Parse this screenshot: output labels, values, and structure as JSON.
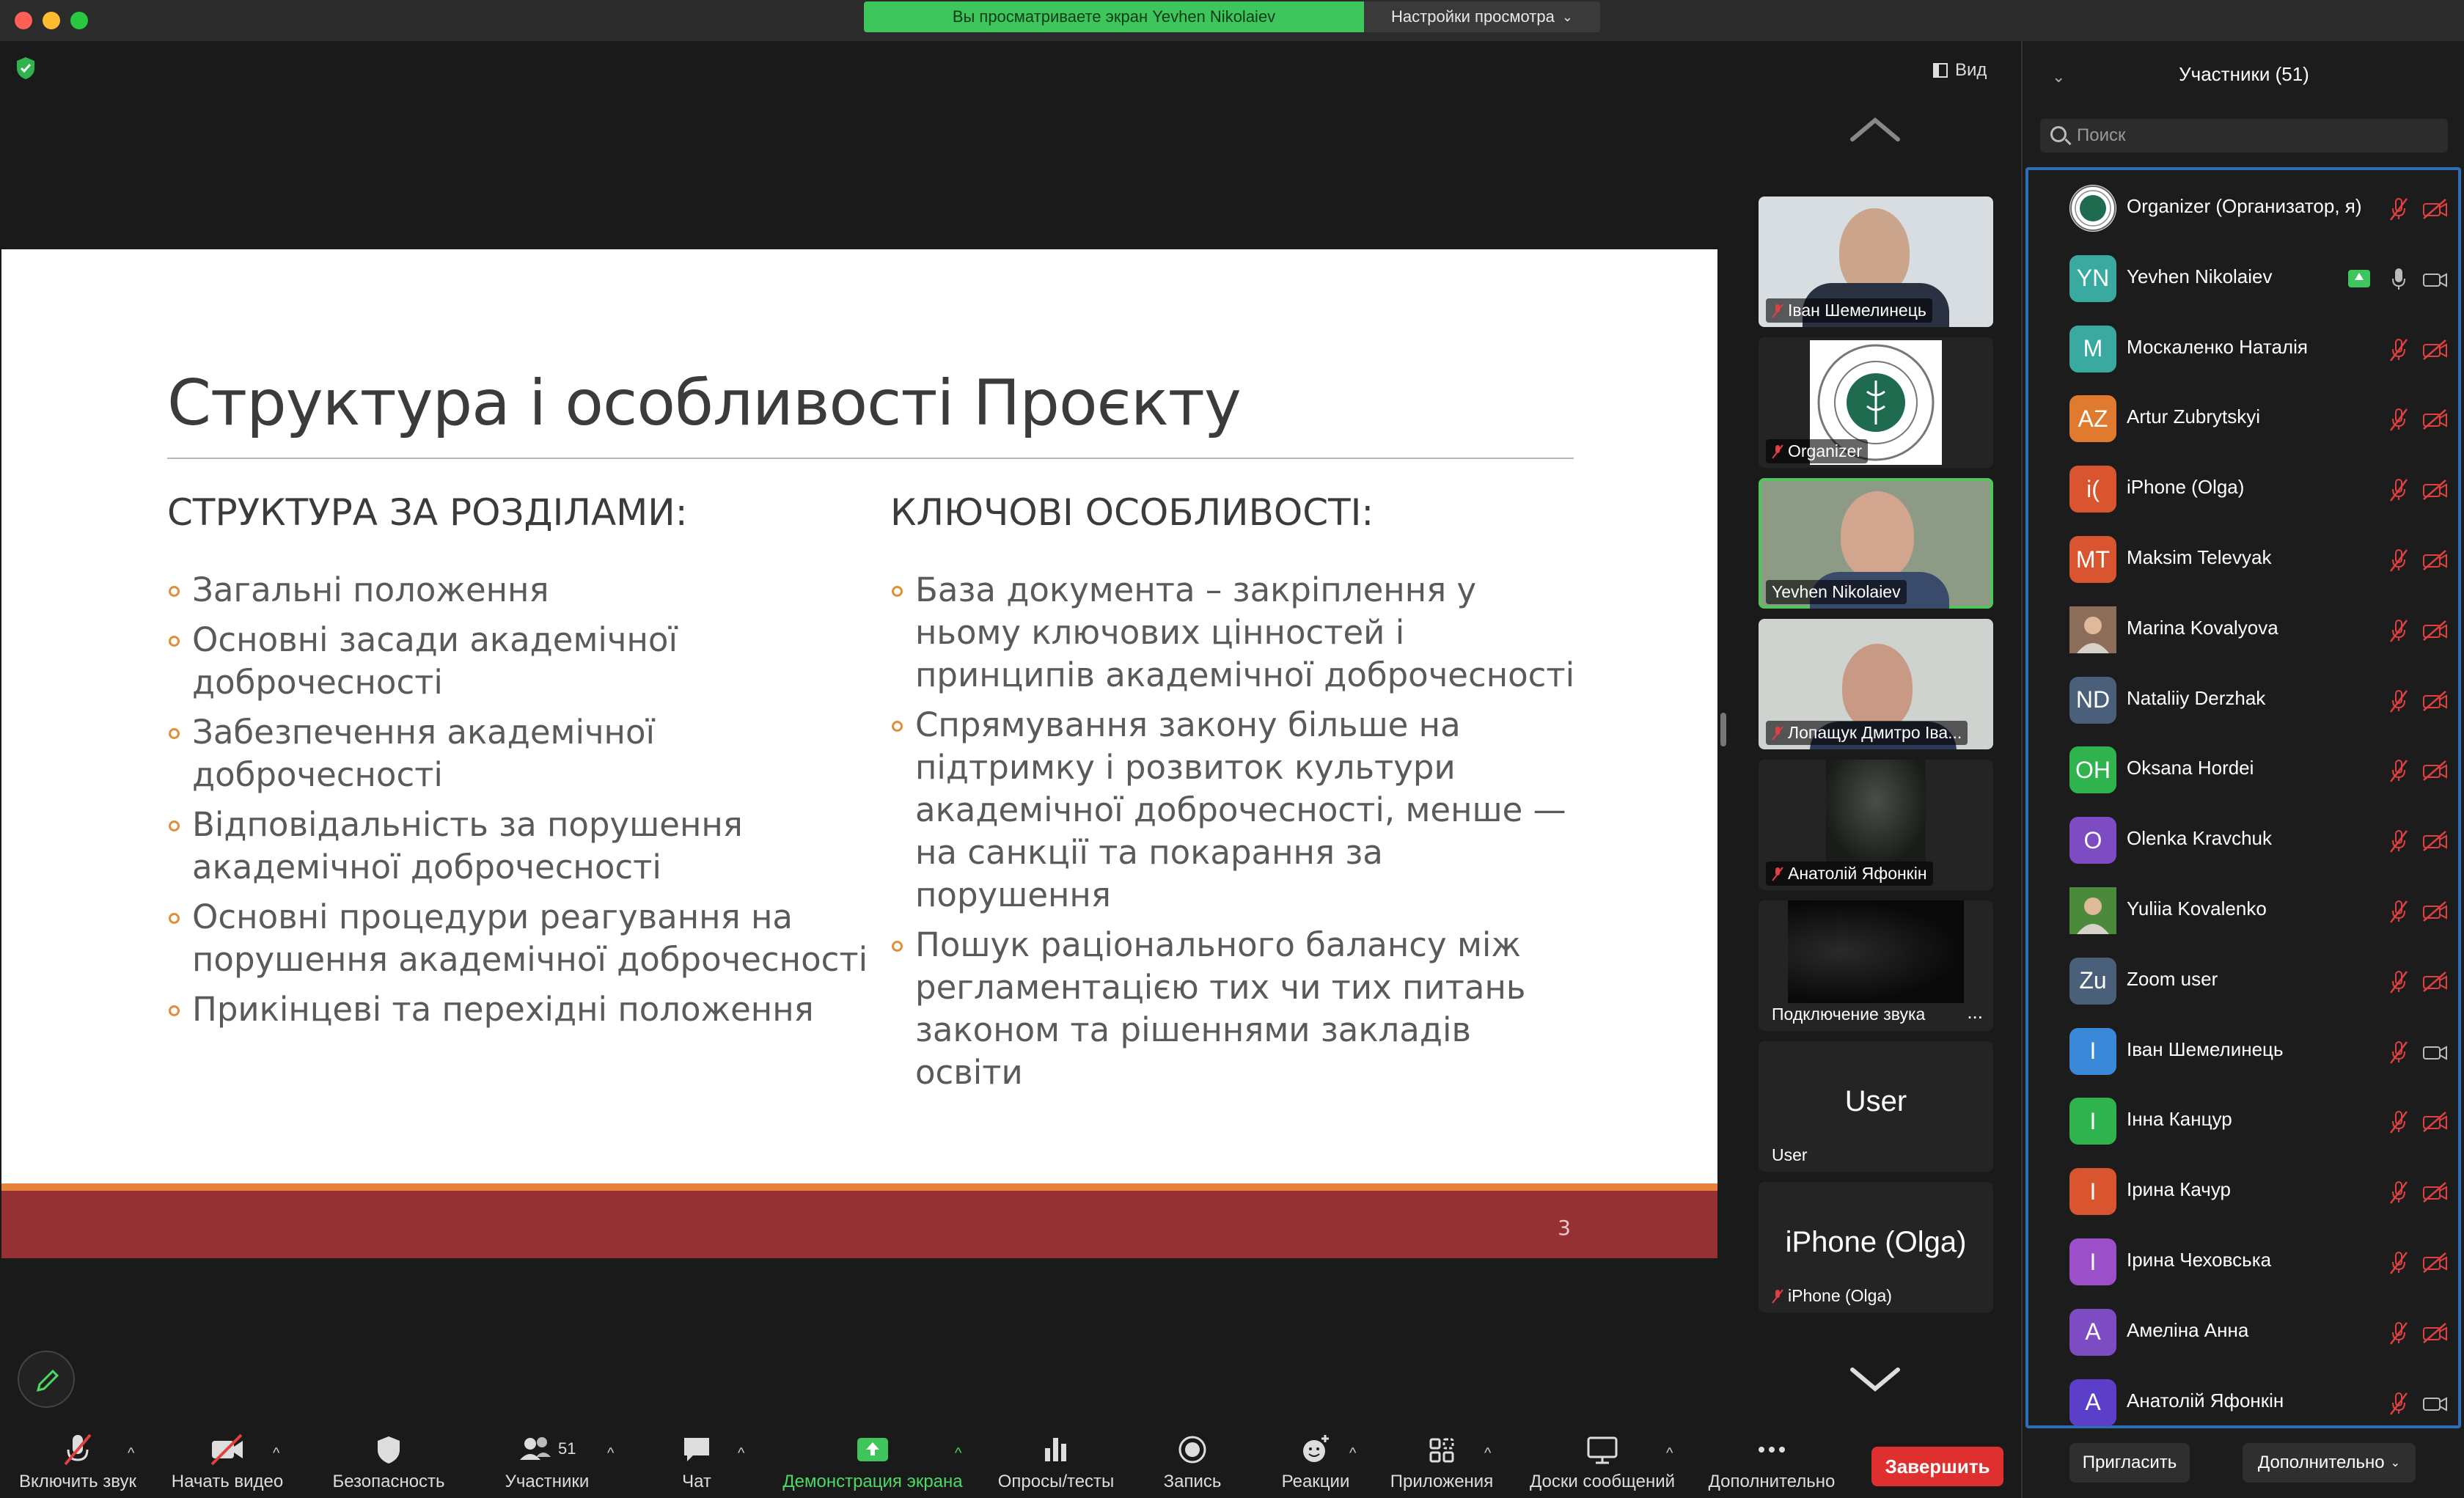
{
  "window": {
    "share_banner": "Вы просматриваете экран Yevhen Nikolaiev",
    "view_settings": "Настройки просмотра",
    "view_button": "Вид"
  },
  "slide": {
    "title": "Структура і особливості Проєкту",
    "left_heading": "СТРУКТУРА ЗА РОЗДІЛАМИ:",
    "left_items": [
      "Загальні положення",
      "Основні засади академічної доброчесності",
      "Забезпечення академічної доброчесності",
      "Відповідальність за порушення академічної доброчесності",
      "Основні процедури реагування на порушення академічної доброчесності",
      "Прикінцеві та перехідні положення"
    ],
    "right_heading": "КЛЮЧОВІ ОСОБЛИВОСТІ:",
    "right_items": [
      "База документа – закріплення у ньому ключових цінностей і принципів академічної доброчесності",
      "Спрямування закону більше на підтримку і розвиток культури академічної доброчесності, менше — на санкції та покарання за порушення",
      "Пошук раціонального балансу між регламентацією тих чи тих питань законом та рішеннями закладів освіти"
    ],
    "page_number": "3"
  },
  "video_tiles": [
    {
      "name": "Іван Шемелинець",
      "muted": true
    },
    {
      "name": "Organizer",
      "muted": true
    },
    {
      "name": "Yevhen Nikolaiev",
      "muted": false,
      "active": true
    },
    {
      "name": "Лопащук Дмитро Іва...",
      "muted": true
    },
    {
      "name": "Анатолій Яфонкін",
      "muted": true
    },
    {
      "name": "Подключение звука",
      "muted": false,
      "more": "..."
    },
    {
      "name": "User",
      "big": "User",
      "muted": false
    },
    {
      "name": "iPhone (Olga)",
      "big": "iPhone (Olga)",
      "muted": true
    }
  ],
  "participants_panel": {
    "title": "Участники (51)",
    "search_placeholder": "Поиск",
    "invite_button": "Пригласить",
    "more_button": "Дополнительно"
  },
  "participants": [
    {
      "initials": "",
      "name": "Organizer (Организатор, я)",
      "color": "#e8e8e8",
      "mic": "muted",
      "cam": "off",
      "image": "seal"
    },
    {
      "initials": "YN",
      "name": "Yevhen Nikolaiev",
      "color": "#3aa99f",
      "mic": "on",
      "cam": "on",
      "sharing": true
    },
    {
      "initials": "M",
      "name": "Москаленко Наталія",
      "color": "#3aa99f",
      "mic": "muted",
      "cam": "off"
    },
    {
      "initials": "AZ",
      "name": "Artur Zubrytskyi",
      "color": "#e07a2e",
      "mic": "muted",
      "cam": "off"
    },
    {
      "initials": "i(",
      "name": "iPhone (Olga)",
      "color": "#d9552f",
      "mic": "muted",
      "cam": "off"
    },
    {
      "initials": "MT",
      "name": "Maksim Televyak",
      "color": "#d9552f",
      "mic": "muted",
      "cam": "off"
    },
    {
      "initials": "",
      "name": "Marina Kovalyova",
      "color": "#8b6d5a",
      "mic": "muted",
      "cam": "off",
      "image": "photo"
    },
    {
      "initials": "ND",
      "name": "Nataliiy Derzhak",
      "color": "#4a5f7a",
      "mic": "muted",
      "cam": "off"
    },
    {
      "initials": "OH",
      "name": "Oksana Hordei",
      "color": "#2fb34f",
      "mic": "muted",
      "cam": "off"
    },
    {
      "initials": "O",
      "name": "Olenka Kravchuk",
      "color": "#7d4bc2",
      "mic": "muted",
      "cam": "off"
    },
    {
      "initials": "",
      "name": "Yuliia Kovalenko",
      "color": "#4a8a3a",
      "mic": "muted",
      "cam": "off",
      "image": "photo"
    },
    {
      "initials": "Zu",
      "name": "Zoom user",
      "color": "#4a5f7a",
      "mic": "muted",
      "cam": "off"
    },
    {
      "initials": "I",
      "name": "Іван Шемелинець",
      "color": "#3a88d8",
      "mic": "muted",
      "cam": "on"
    },
    {
      "initials": "I",
      "name": "Інна Канцур",
      "color": "#2fb34f",
      "mic": "muted",
      "cam": "off"
    },
    {
      "initials": "I",
      "name": "Ірина Качур",
      "color": "#d9552f",
      "mic": "muted",
      "cam": "off"
    },
    {
      "initials": "I",
      "name": "Ірина Чеховська",
      "color": "#9b4fc8",
      "mic": "muted",
      "cam": "off"
    },
    {
      "initials": "A",
      "name": "Амеліна Анна",
      "color": "#7d4bc2",
      "mic": "muted",
      "cam": "off"
    },
    {
      "initials": "A",
      "name": "Анатолій Яфонкін",
      "color": "#5b3fc8",
      "mic": "muted",
      "cam": "on"
    }
  ],
  "toolbar": {
    "mute": "Включить звук",
    "video": "Начать видео",
    "security": "Безопасность",
    "participants": "Участники",
    "participants_count": "51",
    "chat": "Чат",
    "share": "Демонстрация экрана",
    "polls": "Опросы/тесты",
    "record": "Запись",
    "reactions": "Реакции",
    "apps": "Приложения",
    "whiteboards": "Доски сообщений",
    "more": "Дополнительно",
    "end": "Завершить"
  }
}
